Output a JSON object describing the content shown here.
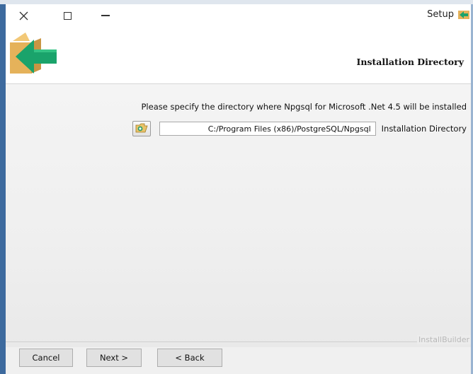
{
  "window": {
    "title": "Setup",
    "controls": {
      "close": "close-icon",
      "maximize": "maximize-icon",
      "minimize": "minimize-icon"
    }
  },
  "header": {
    "title": "Installation Directory",
    "logo_icon": "installer-box-arrow-icon"
  },
  "main": {
    "description": "Please specify the directory where Npgsql for Microsoft .Net 4.5 will be installed",
    "field_label": "Installation Directory",
    "field_value": "C:/Program Files (x86)/PostgreSQL/Npgsql",
    "browse_icon": "folder-browse-icon"
  },
  "footer": {
    "brand": "InstallBuilder",
    "back_label": "< Back",
    "next_label": "Next >",
    "cancel_label": "Cancel"
  },
  "colors": {
    "frame_border": "#3d6a9e",
    "logo_green": "#1aa36b",
    "logo_box": "#e5b25a"
  }
}
